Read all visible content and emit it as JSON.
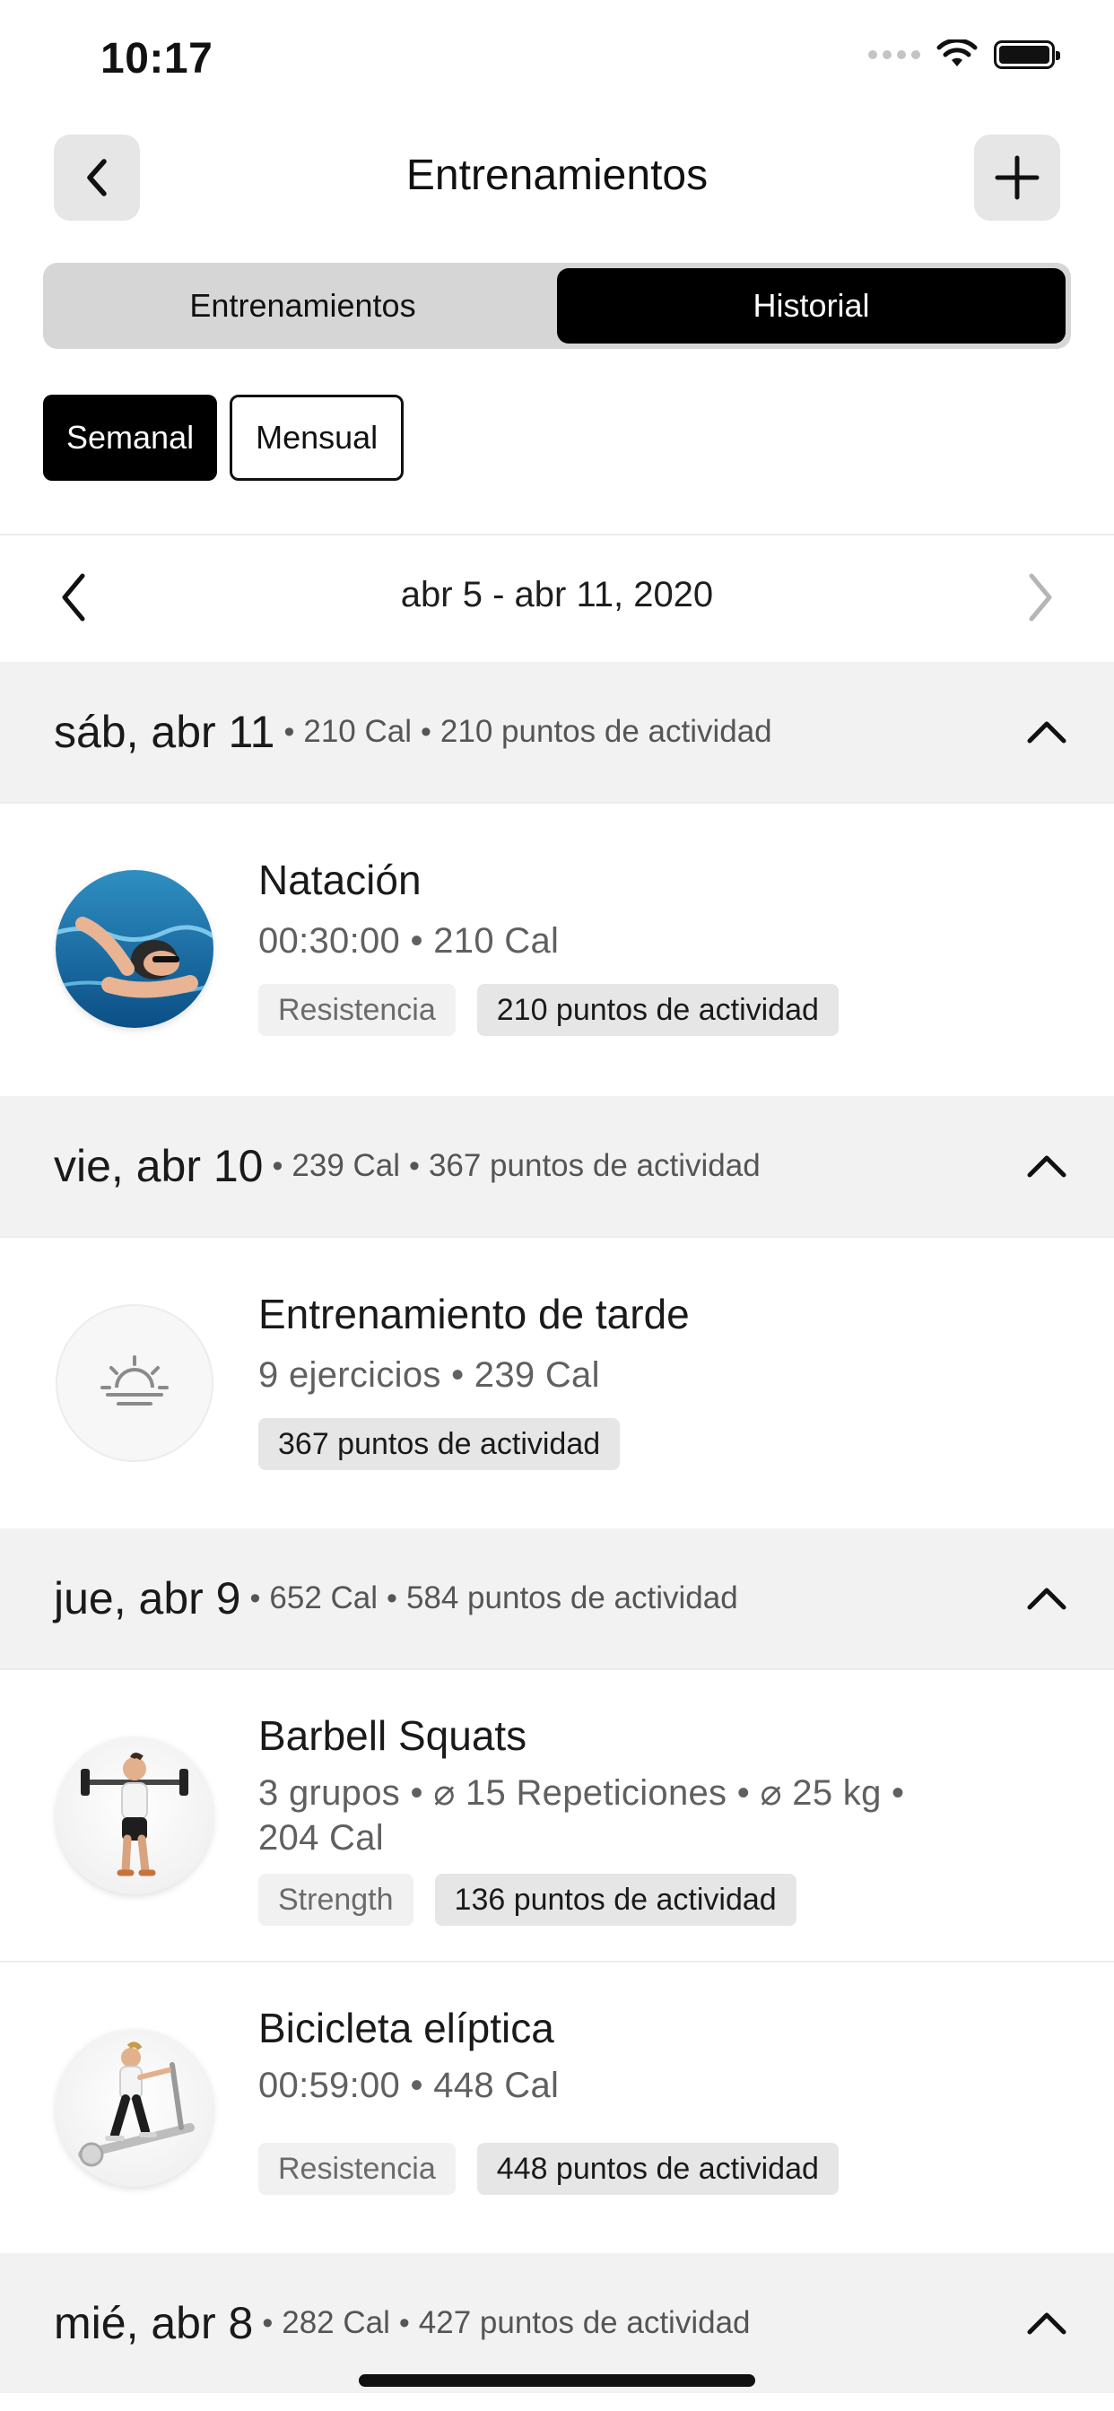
{
  "status_bar": {
    "time": "10:17"
  },
  "header": {
    "title": "Entrenamientos"
  },
  "segments": [
    {
      "label": "Entrenamientos",
      "active": false
    },
    {
      "label": "Historial",
      "active": true
    }
  ],
  "period": {
    "weekly": "Semanal",
    "monthly": "Mensual"
  },
  "date_range": "abr 5 - abr 11, 2020",
  "days": [
    {
      "date": "sáb, abr 11",
      "cal": "210 Cal",
      "points": "210 puntos de actividad",
      "entries": [
        {
          "title": "Natación",
          "meta": "00:30:00 • 210 Cal",
          "category": "Resistencia",
          "points": "210 puntos de actividad",
          "icon": "swimmer-photo"
        }
      ]
    },
    {
      "date": "vie, abr 10",
      "cal": "239 Cal",
      "points": "367 puntos de actividad",
      "entries": [
        {
          "title": "Entrenamiento de tarde",
          "meta": "9 ejercicios • 239 Cal",
          "points": "367 puntos de actividad",
          "icon": "sunset-icon"
        }
      ]
    },
    {
      "date": "jue, abr 9",
      "cal": "652 Cal",
      "points": "584 puntos de actividad",
      "entries": [
        {
          "title": "Barbell Squats",
          "meta_line1": "3 grupos • ⌀ 15 Repeticiones • ⌀ 25 kg •",
          "meta_line2": "204 Cal",
          "category": "Strength",
          "points": "136 puntos de actividad",
          "icon": "barbell-squat-figure"
        },
        {
          "title": "Bicicleta elíptica",
          "meta": "00:59:00 • 448 Cal",
          "category": "Resistencia",
          "points": "448 puntos de actividad",
          "icon": "elliptical-figure"
        }
      ]
    },
    {
      "date": "mié, abr 8",
      "cal": "282 Cal",
      "points": "427 puntos de actividad",
      "entries": []
    }
  ]
}
